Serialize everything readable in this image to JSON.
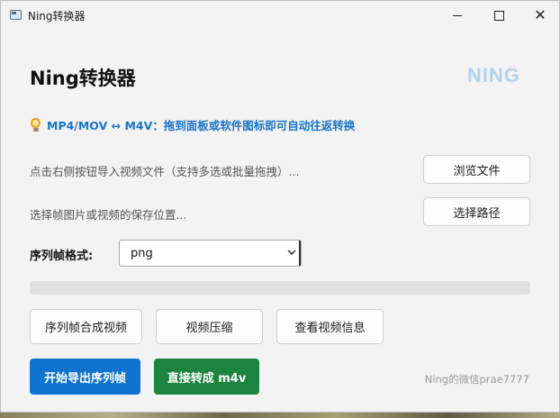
{
  "window": {
    "title": "Ning转换器",
    "icon": "app-window-icon",
    "controls": {
      "minimize": "minimize-icon",
      "maximize": "maximize-icon",
      "close": "close-icon"
    }
  },
  "header": {
    "title": "Ning转换器",
    "logo_text": "NING"
  },
  "tip": {
    "icon": "lightbulb-icon",
    "text": "MP4/MOV ↔ M4V：拖到面板或软件图标即可自动往返转换"
  },
  "file_row": {
    "hint": "点击右侧按钮导入视频文件（支持多选或批量拖拽）...",
    "button_label": "浏览文件"
  },
  "path_row": {
    "hint": "选择帧图片或视频的保存位置...",
    "button_label": "选择路径"
  },
  "format_row": {
    "label": "序列帧格式:",
    "selected": "png"
  },
  "progress": {
    "value": 0
  },
  "tools": {
    "merge_label": "序列帧合成视频",
    "compress_label": "视频压缩",
    "info_label": "查看视频信息"
  },
  "actions": {
    "export_label": "开始导出序列帧",
    "convert_label": "直接转成 m4v"
  },
  "footer": {
    "credit": "Ning的微信prae7777"
  },
  "colors": {
    "accent_blue": "#0e73cf",
    "accent_green": "#1d8440",
    "tip_text": "#1a73c8",
    "logo": "#b3d0ec"
  }
}
